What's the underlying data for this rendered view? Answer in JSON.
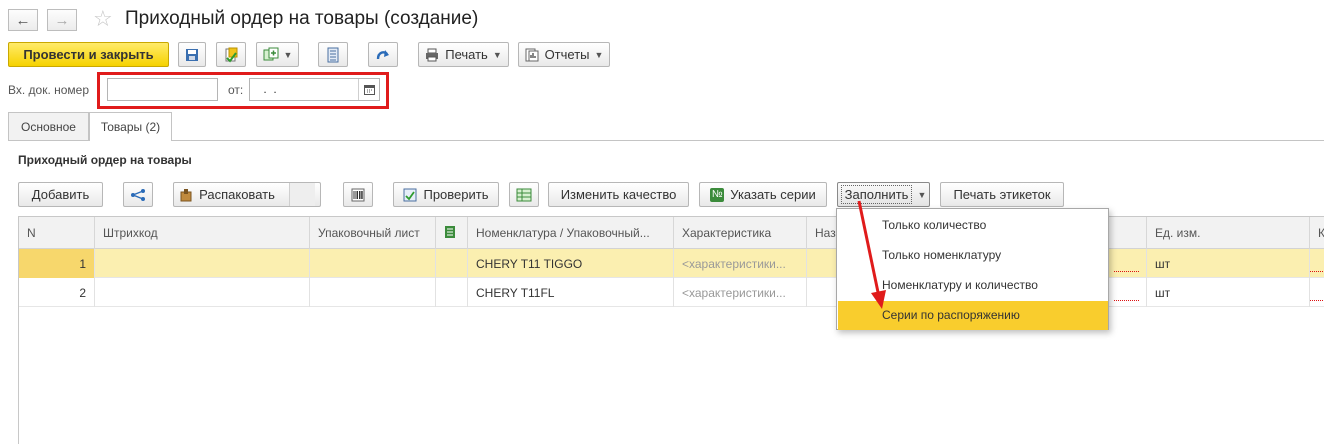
{
  "window": {
    "title": "Приходный ордер на товары (создание)"
  },
  "toolbar": {
    "post_close_label": "Провести и закрыть",
    "print_label": "Печать",
    "reports_label": "Отчеты"
  },
  "header_fields": {
    "doc_number_label": "Вх. док. номер",
    "doc_number_value": "",
    "date_label": "от:",
    "date_value": " .  ."
  },
  "tabs": [
    {
      "label": "Основное",
      "active": false
    },
    {
      "label": "Товары (2)",
      "active": true
    }
  ],
  "section": {
    "title": "Приходный ордер на товары"
  },
  "grid_toolbar": {
    "add_label": "Добавить",
    "unpack_label": "Распаковать",
    "check_label": "Проверить",
    "change_quality_label": "Изменить качество",
    "set_series_label": "Указать серии",
    "fill_label": "Заполнить",
    "print_labels_label": "Печать этикеток"
  },
  "table": {
    "columns": [
      "N",
      "Штрихкод",
      "Упаковочный лист",
      "",
      "Номенклатура / Упаковочный...",
      "Характеристика",
      "Наз",
      "Ед. изм.",
      "К"
    ],
    "rows": [
      {
        "n": "1",
        "barcode": "",
        "pack_list": "",
        "nomenclature": "CHERY T11 TIGGO",
        "characteristic": "<характеристики...",
        "unit": "шт",
        "selected": true
      },
      {
        "n": "2",
        "barcode": "",
        "pack_list": "",
        "nomenclature": "CHERY T11FL",
        "characteristic": "<характеристики...",
        "unit": "шт",
        "selected": false
      }
    ]
  },
  "fill_menu": {
    "items": [
      {
        "label": "Только количество",
        "highlighted": false
      },
      {
        "label": "Только номенклатуру",
        "highlighted": false
      },
      {
        "label": "Номенклатуру и количество",
        "highlighted": false
      },
      {
        "label": "Серии по распоряжению",
        "highlighted": true
      }
    ]
  },
  "colors": {
    "primary_button": "#f6d200",
    "highlight": "#f9cd2d",
    "selected_row": "#fbefb0",
    "annotation_red": "#e01b1b"
  }
}
